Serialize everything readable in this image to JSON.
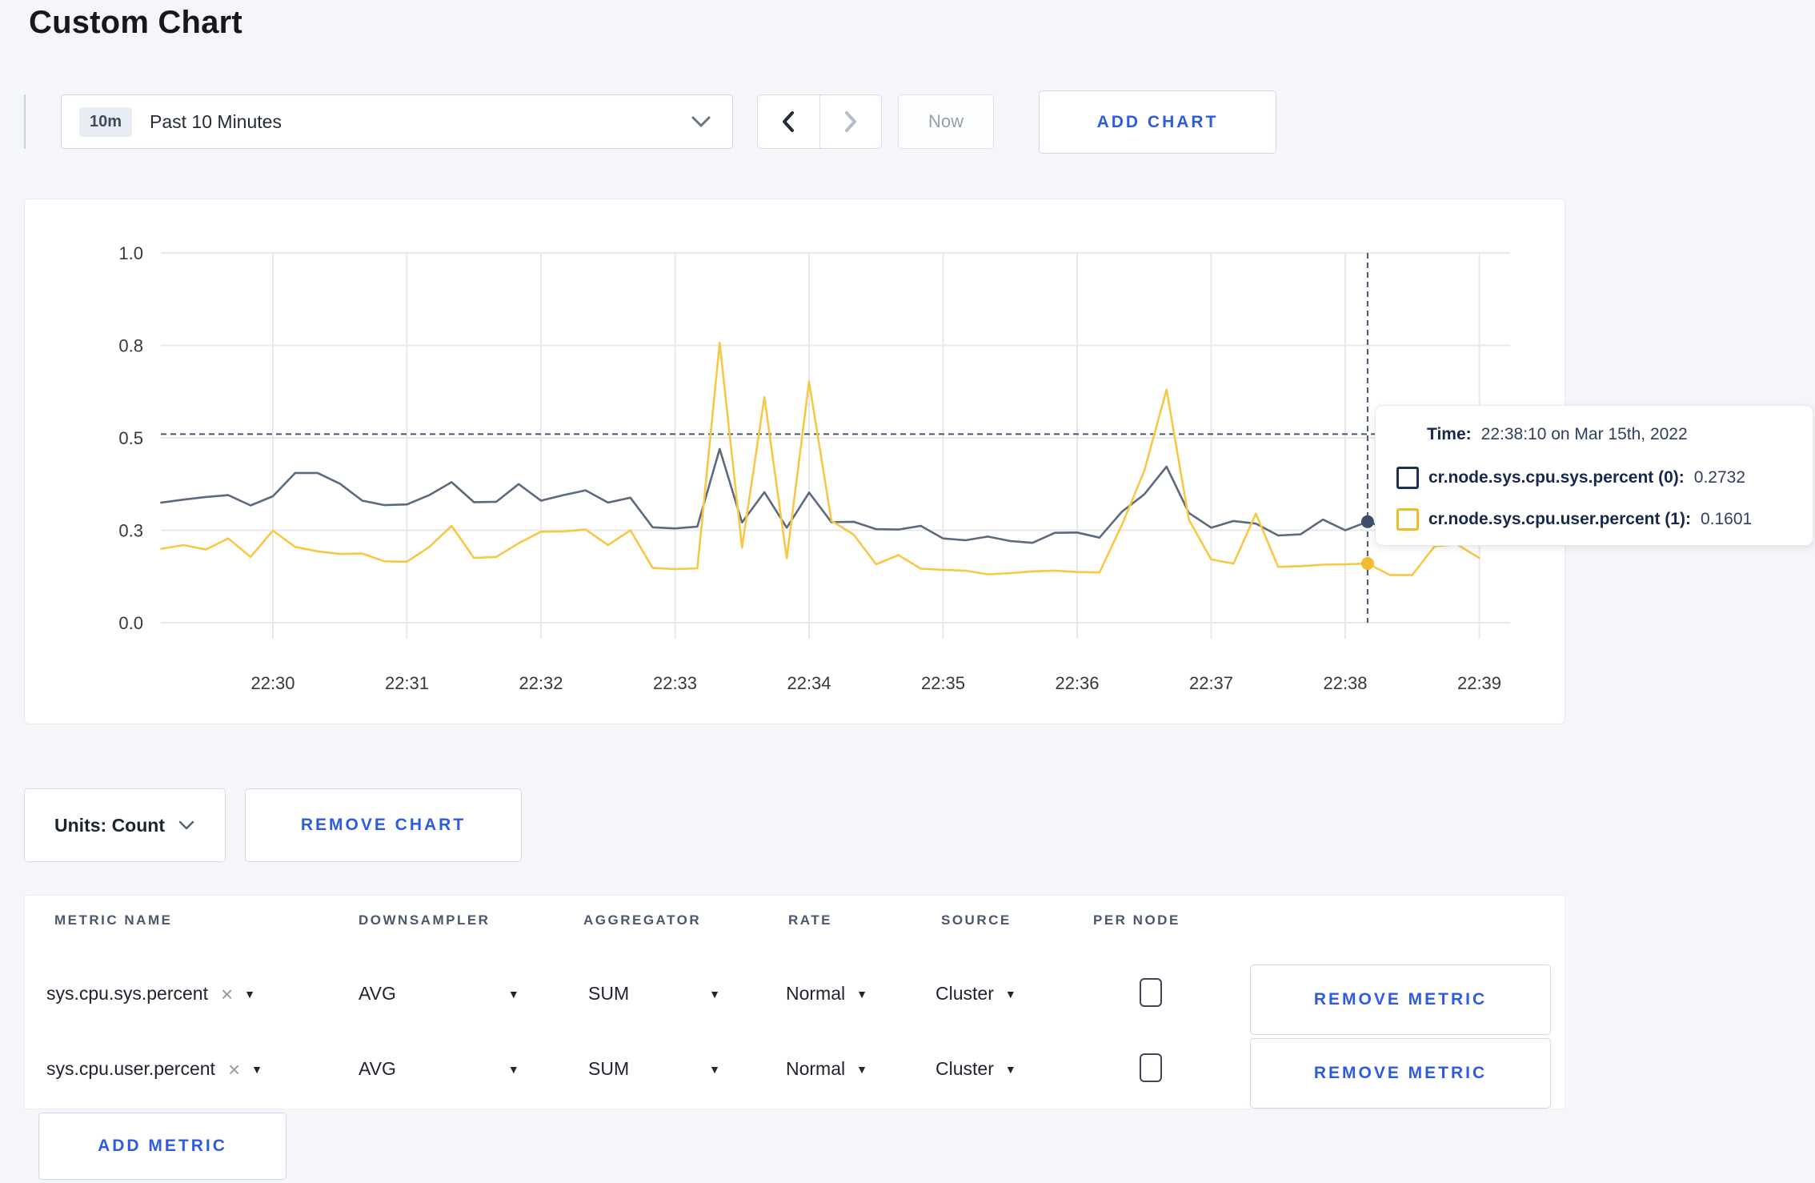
{
  "page": {
    "title": "Custom Chart"
  },
  "toolbar": {
    "timescale_badge": "10m",
    "timescale_label": "Past 10 Minutes",
    "now_label": "Now",
    "add_chart_label": "ADD CHART"
  },
  "tooltip": {
    "time_label": "Time:",
    "time_value": "22:38:10 on Mar 15th, 2022",
    "series": [
      {
        "label": "cr.node.sys.cpu.sys.percent (0):",
        "value": "0.2732"
      },
      {
        "label": "cr.node.sys.cpu.user.percent (1):",
        "value": "0.1601"
      }
    ]
  },
  "chart_controls": {
    "units_label": "Units: Count",
    "remove_chart_label": "REMOVE CHART"
  },
  "chart_data": {
    "type": "line",
    "title": "",
    "xlabel": "",
    "ylabel": "",
    "ylim": [
      0,
      1
    ],
    "grid": true,
    "y_ticks": [
      {
        "v": 0.0,
        "label": "0.0"
      },
      {
        "v": 0.25,
        "label": "0.3"
      },
      {
        "v": 0.5,
        "label": "0.5"
      },
      {
        "v": 0.75,
        "label": "0.8"
      },
      {
        "v": 1.0,
        "label": "1.0"
      }
    ],
    "x_tick_labels": [
      "22:30",
      "22:31",
      "22:32",
      "22:33",
      "22:34",
      "22:35",
      "22:36",
      "22:37",
      "22:38",
      "22:39"
    ],
    "x_start_time": "22:29:10",
    "x_step_seconds": 10,
    "series": [
      {
        "name": "cr.node.sys.cpu.sys.percent (0)",
        "color": "#5c6a80",
        "marker_color": "#3f4e68",
        "values": [
          0.325,
          0.333,
          0.34,
          0.345,
          0.317,
          0.342,
          0.405,
          0.405,
          0.376,
          0.33,
          0.318,
          0.32,
          0.345,
          0.38,
          0.326,
          0.327,
          0.375,
          0.33,
          0.345,
          0.358,
          0.325,
          0.338,
          0.258,
          0.255,
          0.26,
          0.47,
          0.271,
          0.353,
          0.257,
          0.352,
          0.272,
          0.273,
          0.253,
          0.252,
          0.262,
          0.228,
          0.223,
          0.233,
          0.221,
          0.216,
          0.243,
          0.244,
          0.23,
          0.3,
          0.347,
          0.422,
          0.297,
          0.257,
          0.275,
          0.268,
          0.236,
          0.239,
          0.279,
          0.25,
          0.2732,
          0.252,
          0.248,
          0.26,
          0.27,
          0.283
        ]
      },
      {
        "name": "cr.node.sys.cpu.user.percent (1)",
        "color": "#f8c845",
        "marker_color": "#f2bb32",
        "values": [
          0.2,
          0.21,
          0.198,
          0.228,
          0.178,
          0.249,
          0.205,
          0.193,
          0.186,
          0.187,
          0.166,
          0.165,
          0.205,
          0.262,
          0.175,
          0.178,
          0.215,
          0.246,
          0.247,
          0.252,
          0.21,
          0.25,
          0.148,
          0.145,
          0.147,
          0.757,
          0.203,
          0.61,
          0.174,
          0.652,
          0.276,
          0.238,
          0.158,
          0.183,
          0.146,
          0.143,
          0.141,
          0.131,
          0.134,
          0.139,
          0.141,
          0.137,
          0.136,
          0.264,
          0.41,
          0.63,
          0.279,
          0.171,
          0.16,
          0.295,
          0.151,
          0.153,
          0.157,
          0.158,
          0.1601,
          0.129,
          0.129,
          0.207,
          0.212,
          0.175
        ]
      }
    ],
    "crosshair": {
      "time": "22:38:10",
      "h_value": 0.51
    },
    "highlighted": {
      "time": "22:38:10",
      "values": [
        0.2732,
        0.1601
      ]
    },
    "legend_position": "tooltip-overlay"
  },
  "metrics_table": {
    "headers": [
      "METRIC NAME",
      "DOWNSAMPLER",
      "AGGREGATOR",
      "RATE",
      "SOURCE",
      "PER NODE"
    ],
    "remove_metric_label": "REMOVE METRIC",
    "add_metric_label": "ADD METRIC",
    "rows": [
      {
        "name": "sys.cpu.sys.percent",
        "downsampler": "AVG",
        "aggregator": "SUM",
        "rate": "Normal",
        "source": "Cluster",
        "per_node_checked": false
      },
      {
        "name": "sys.cpu.user.percent",
        "downsampler": "AVG",
        "aggregator": "SUM",
        "rate": "Normal",
        "source": "Cluster",
        "per_node_checked": false
      }
    ]
  },
  "icons": {
    "clear": "×",
    "caret": "▼"
  },
  "colors": {
    "accent_blue": "#2e5be4",
    "series_sys": "#5c6a80",
    "series_user": "#f8c845",
    "crosshair": "#47596f",
    "page_bg": "#f4f6f9"
  }
}
